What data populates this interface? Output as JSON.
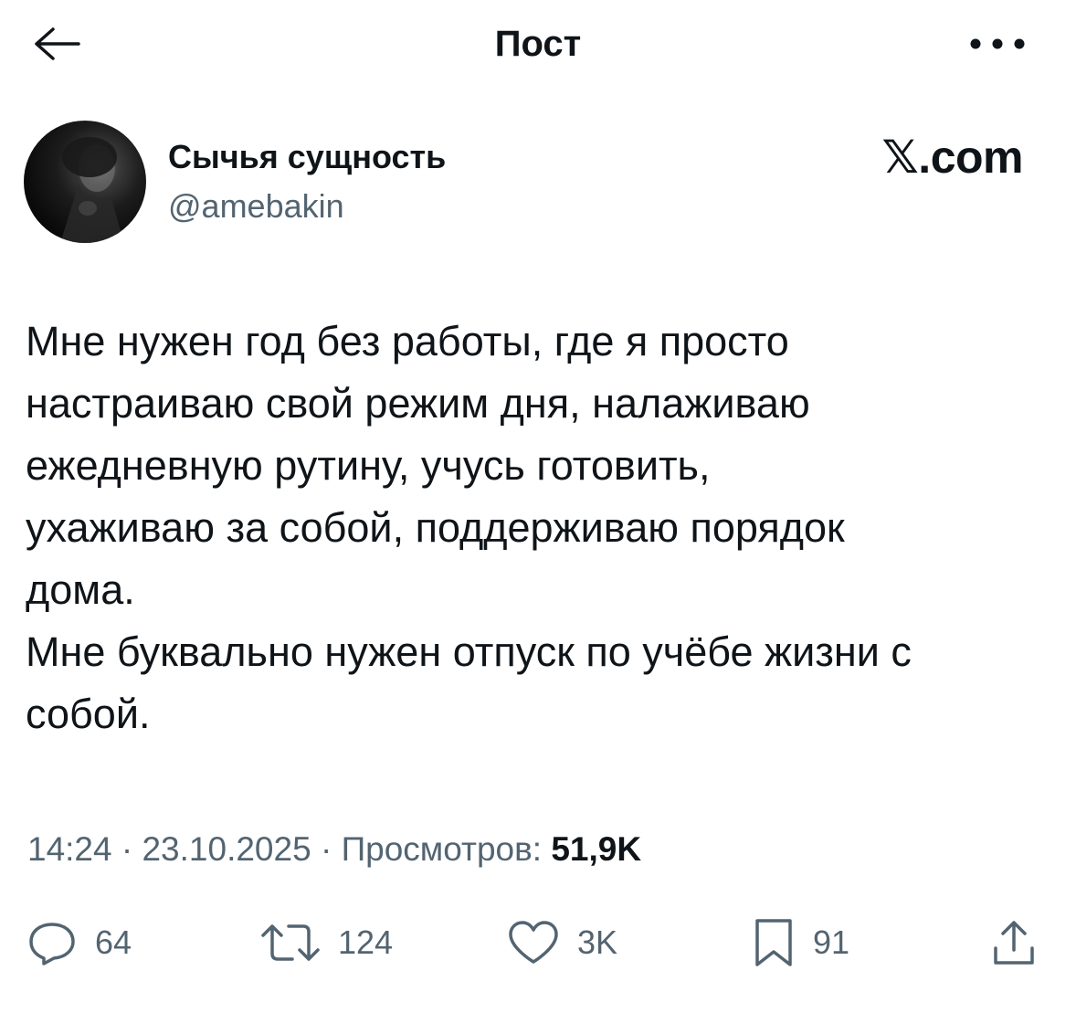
{
  "header": {
    "title": "Пост",
    "back_icon": "arrow-left-icon",
    "more_icon": "more-horizontal-icon"
  },
  "author": {
    "name": "Сычья сущность",
    "handle": "@amebakin",
    "avatar_icon": "avatar-photo"
  },
  "brand": {
    "label": "𝕏.com"
  },
  "post": {
    "lines": [
      "Мне нужен год без работы, где я просто",
      "настраиваю свой режим дня, налаживаю",
      "ежедневную рутину, учусь готовить,",
      "ухаживаю за собой, поддерживаю порядок",
      "дома.",
      "Мне буквально нужен отпуск по учёбе жизни с",
      "собой."
    ]
  },
  "meta": {
    "time": "14:24",
    "separator": " · ",
    "date": "23.10.2025",
    "views_label": "Просмотров: ",
    "views_count": "51,9K"
  },
  "actions": {
    "replies": {
      "icon": "reply-icon",
      "count": "64"
    },
    "reposts": {
      "icon": "repost-icon",
      "count": "124"
    },
    "likes": {
      "icon": "heart-icon",
      "count": "3K"
    },
    "bookmarks": {
      "icon": "bookmark-icon",
      "count": "91"
    },
    "share": {
      "icon": "share-icon"
    }
  },
  "colors": {
    "text": "#0f1419",
    "secondary": "#536471",
    "background": "#ffffff"
  }
}
